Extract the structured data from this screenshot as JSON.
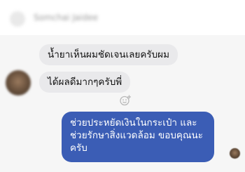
{
  "header": {
    "contact_name": "Somchai Jaidee"
  },
  "messages": [
    {
      "text": "น้ำยาเห็นผมชัดเจนเลยครับผม"
    },
    {
      "text": "ได้ผลดีมากๆครับพี่"
    },
    {
      "lines": [
        "ช่วยประหยัดเงินในกระเป๋า และ",
        "ช่วยรักษาสิ่งแวดล้อม ขอบคุณนะ",
        "ครับ"
      ]
    }
  ],
  "icons": {
    "contact_avatar": "avatar",
    "react": "smiley-plus-icon",
    "seen": "seen-avatar"
  },
  "colors": {
    "outgoing_bubble": "#3b5db5",
    "incoming_bubble": "#e9e9eb",
    "thread_background": "#f6f6f6"
  }
}
